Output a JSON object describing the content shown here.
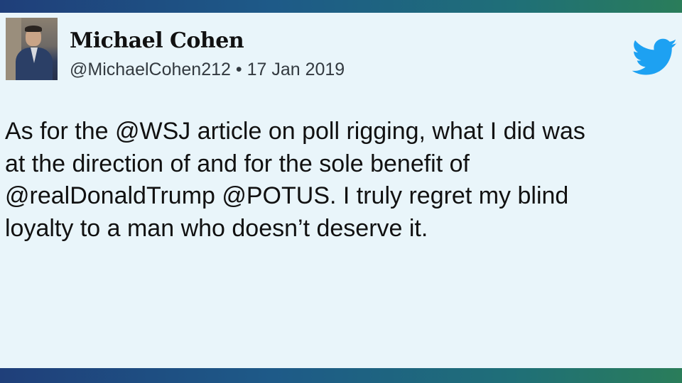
{
  "tweet": {
    "author_name": "Michael Cohen",
    "handle": "@MichaelCohen212",
    "separator": " • ",
    "date": "17 Jan 2019",
    "lines": [
      "As for the @WSJ article on poll rigging, what I did was",
      "at the direction of and for the sole benefit of",
      "@realDonaldTrump @POTUS. I truly regret my blind",
      "loyalty to a man who doesn’t deserve it."
    ]
  },
  "icons": {
    "brand": "twitter-bird-icon",
    "avatar": "profile-photo"
  },
  "colors": {
    "card_background": "#e9f5fa",
    "twitter_blue": "#1da1f2",
    "banner_gradient_start": "#1f3f7a",
    "banner_gradient_end": "#2a7d5a"
  }
}
